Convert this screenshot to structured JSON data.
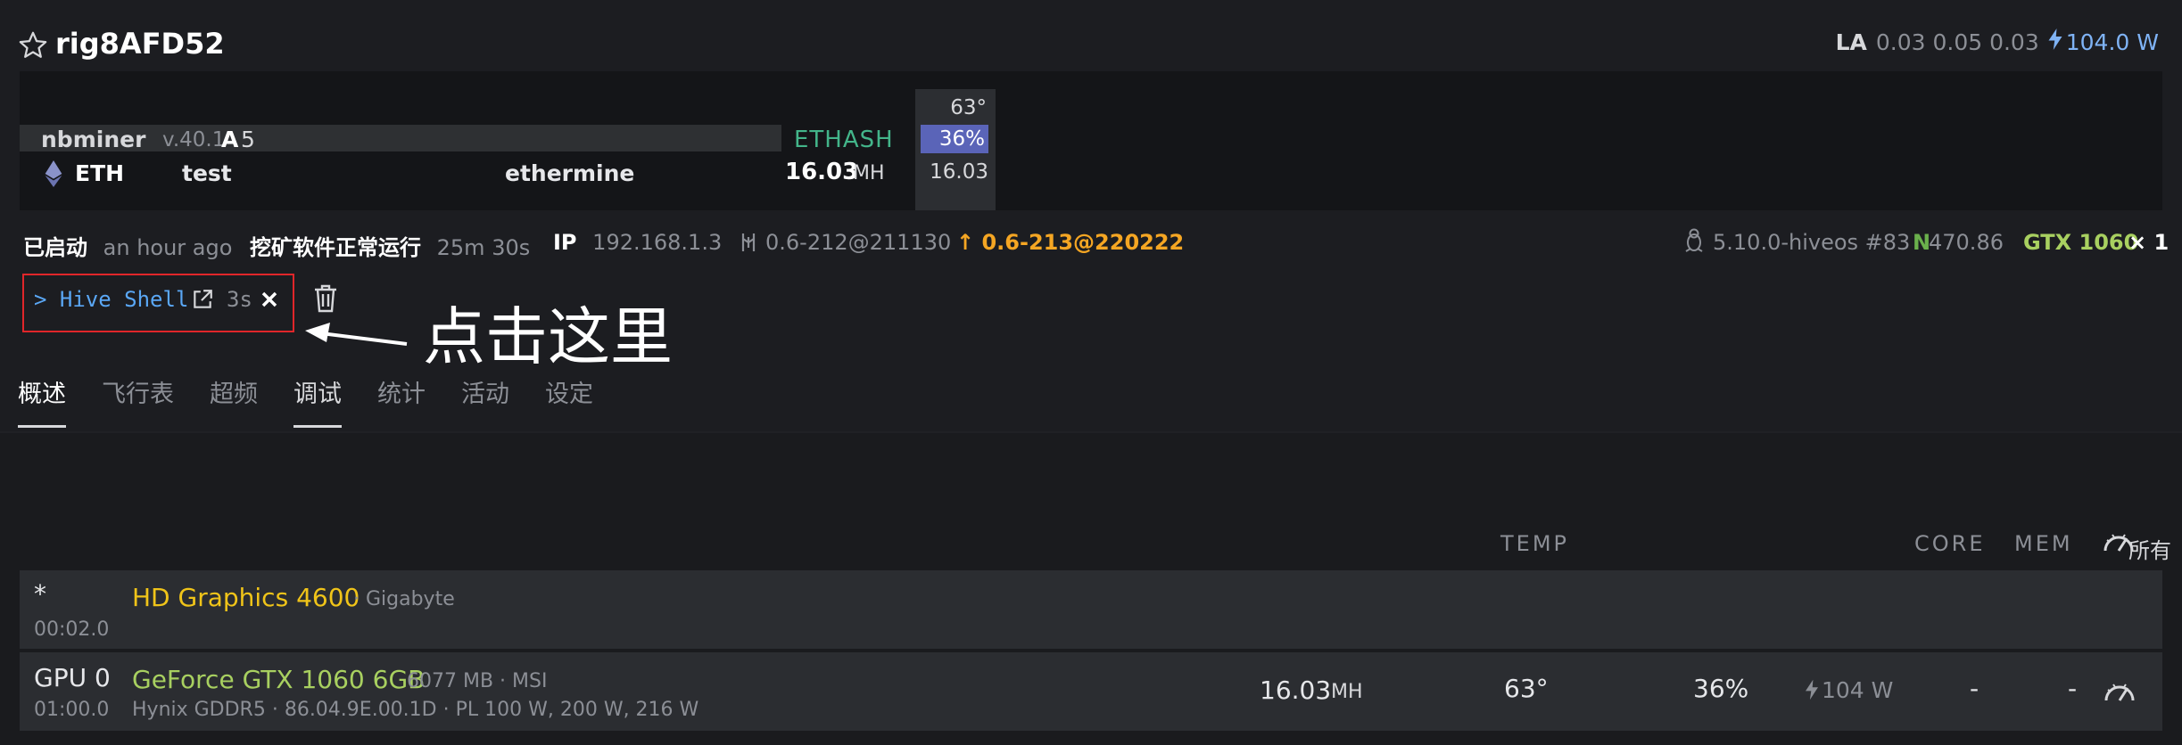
{
  "header": {
    "rig_name": "rig8AFD52",
    "la_label": "LA",
    "la_values": "0.03 0.05 0.03",
    "power": "104.0 W"
  },
  "miner": {
    "name": "nbminer",
    "version": "v.40.1",
    "a_label": "A",
    "a_value": "5",
    "algo": "ETHASH",
    "coin": "ETH",
    "wallet": "test",
    "pool": "ethermine",
    "hashrate": "16.03",
    "hashrate_unit": "MH",
    "stats": {
      "temp": "63°",
      "fan": "36%",
      "hash": "16.03"
    }
  },
  "info": {
    "status_label": "已启动",
    "status_time": "an hour ago",
    "miner_status": "挖矿软件正常运行",
    "miner_uptime": "25m 30s",
    "ip_label": "IP",
    "ip": "192.168.1.3",
    "version": "0.6-212@211130",
    "upgrade_version": "0.6-213@220222",
    "kernel": "5.10.0-hiveos #83",
    "n_label": "N",
    "n_value": "470.86",
    "gpu_model": "GTX 1060",
    "gpu_count": "× 1"
  },
  "shell": {
    "link_text": "> Hive Shell",
    "timer": "3s"
  },
  "annotation": "点击这里",
  "tabs": [
    {
      "label": "概述"
    },
    {
      "label": "飞行表"
    },
    {
      "label": "超频"
    },
    {
      "label": "调试"
    },
    {
      "label": "统计"
    },
    {
      "label": "活动"
    },
    {
      "label": "设定"
    }
  ],
  "table": {
    "headers": {
      "temp": "TEMP",
      "core": "CORE",
      "mem": "MEM",
      "all": "所有"
    },
    "rows": [
      {
        "id": "*",
        "bus": "00:02.0",
        "name": "HD Graphics 4600",
        "vendor": "· Gigabyte"
      },
      {
        "id": "GPU 0",
        "bus": "01:00.0",
        "name": "GeForce GTX 1060 6GB",
        "meta": "6077 MB · MSI",
        "details": "Hynix GDDR5 · 86.04.9E.00.1D · PL 100 W, 200 W, 216 W",
        "hashrate": "16.03",
        "hashrate_unit": "MH",
        "temp": "63°",
        "fan": "36%",
        "power": "104 W",
        "core": "-",
        "mem": "-"
      }
    ]
  },
  "colors": {
    "accent_blue": "#5aa7f5",
    "algo_green": "#43b58a",
    "upgrade_orange": "#f5a623",
    "gpu_green": "#a8d060",
    "intel_yellow": "#f0c419",
    "fan_bar": "#5a64b8",
    "highlight_red": "#e0262a"
  }
}
